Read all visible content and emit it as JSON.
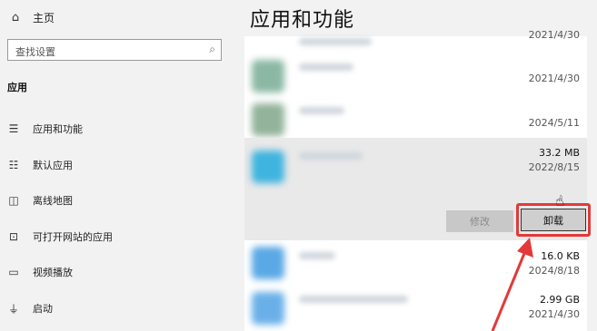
{
  "sidebar": {
    "home": "主页",
    "search_placeholder": "查找设置",
    "section": "应用",
    "items": [
      {
        "label": "应用和功能"
      },
      {
        "label": "默认应用"
      },
      {
        "label": "离线地图"
      },
      {
        "label": "可打开网站的应用"
      },
      {
        "label": "视频播放"
      },
      {
        "label": "启动"
      }
    ]
  },
  "main": {
    "title": "应用和功能",
    "apps": [
      {
        "date": "2021/4/30",
        "size": ""
      },
      {
        "date": "2021/4/30",
        "size": ""
      },
      {
        "date": "2024/5/11",
        "size": ""
      },
      {
        "date": "2022/8/15",
        "size": "33.2 MB"
      },
      {
        "date": "2024/8/18",
        "size": "16.0 KB"
      },
      {
        "date": "2021/4/30",
        "size": "2.99 GB"
      }
    ],
    "modify_label": "修改",
    "uninstall_label": "卸载"
  },
  "colors": {
    "highlight": "#e23a3a",
    "arrow": "#e23a3a"
  }
}
